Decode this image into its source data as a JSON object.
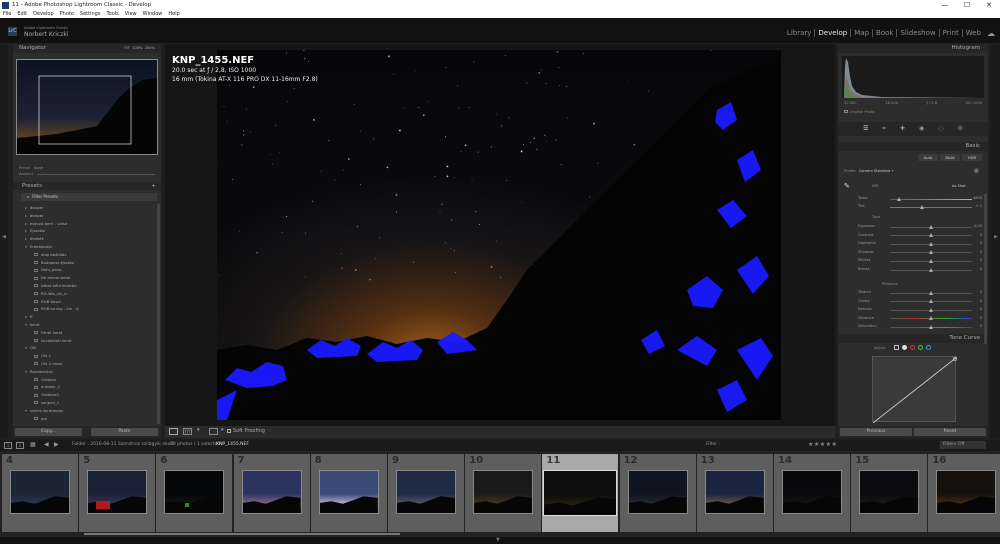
{
  "window": {
    "title": "11 - Adobe Photoshop Lightroom Classic - Develop",
    "min": "—",
    "max": "☐",
    "close": "✕"
  },
  "menu": [
    "File",
    "Edit",
    "Develop",
    "Photo",
    "Settings",
    "Tools",
    "View",
    "Window",
    "Help"
  ],
  "identity": {
    "badge": "LrC",
    "app": "Adobe Lightroom Classic",
    "user": "Norbert Kriczki"
  },
  "modules": [
    "Library",
    "Develop",
    "Map",
    "Book",
    "Slideshow",
    "Print",
    "Web"
  ],
  "active_module": "Develop",
  "left": {
    "navigator_label": "Navigator",
    "zoom": [
      "FIT",
      "100%",
      "200%"
    ],
    "preset_label": "Preset",
    "preset_value": "None",
    "amount_label": "Amount",
    "presets_label": "Presets",
    "filter_presets": "Filter Presets",
    "preset_items": [
      {
        "kind": "folder",
        "text": "áloszer"
      },
      {
        "kind": "folder",
        "text": "áloszer"
      },
      {
        "kind": "folder",
        "text": "eskuvő berri - valsa"
      },
      {
        "kind": "folder",
        "text": "Ejszakai"
      },
      {
        "kind": "folder",
        "text": "életkék"
      },
      {
        "kind": "folder",
        "text": "Erellátszats",
        "open": true
      },
      {
        "kind": "child",
        "text": "alap beállítás"
      },
      {
        "kind": "child",
        "text": "Budapest éjszaka"
      },
      {
        "kind": "child",
        "text": "Dahl_picsa"
      },
      {
        "kind": "child",
        "text": "De menanamal"
      },
      {
        "kind": "child",
        "text": "kékes kéúl keretbe"
      },
      {
        "kind": "child",
        "text": "RG-lálb_vin_lc"
      },
      {
        "kind": "child",
        "text": "RGB Basal"
      },
      {
        "kind": "child",
        "text": "RGB tuning - vin - lc"
      },
      {
        "kind": "folder",
        "text": "ff"
      },
      {
        "kind": "folder",
        "text": "keret",
        "open": true
      },
      {
        "kind": "child",
        "text": "Fehér keret"
      },
      {
        "kind": "child",
        "text": "kaveküreti keret"
      },
      {
        "kind": "folder",
        "text": "Oki",
        "open": true
      },
      {
        "kind": "child",
        "text": "Oki-1"
      },
      {
        "kind": "child",
        "text": "Oki-2-mask"
      },
      {
        "kind": "folder",
        "text": "Randezvány",
        "open": true
      },
      {
        "kind": "child",
        "text": "Outdoor"
      },
      {
        "kind": "child",
        "text": "outdoor_1"
      },
      {
        "kind": "child",
        "text": "Outdoor2"
      },
      {
        "kind": "child",
        "text": "sonped_1"
      },
      {
        "kind": "folder",
        "text": "színes kontraszos",
        "open": true
      },
      {
        "kind": "child",
        "text": "adi"
      }
    ],
    "copy_label": "Copy...",
    "paste_label": "Paste"
  },
  "photo": {
    "filename": "KNP_1455.NEF",
    "exposure_line": "20.0 sec at ƒ / 2,8, ISO 1000",
    "lens_line": "16 mm (Tokina AT-X 116 PRO DX 11-16mm F2.8)"
  },
  "toolbar": {
    "soft_proofing": "Soft Proofing"
  },
  "right": {
    "histogram_label": "Histogram",
    "hist_info": [
      "30 SEC",
      "16 mm",
      "ƒ / 2,8",
      "ISO 1000"
    ],
    "original_photo": "Original Photo",
    "basic_label": "Basic",
    "treat_buttons": [
      "Auto",
      "B&W",
      "HDR"
    ],
    "profile_label": "Profile:",
    "profile_value": "Camera Standard",
    "wb_label": "WB:",
    "wb_value": "As Shot",
    "temp_label": "Temp",
    "temp_value": "4800",
    "tint_label": "Tint",
    "tint_value": "+ 1",
    "tone_label": "Tone",
    "sliders_tone": [
      {
        "label": "Exposure",
        "value": "0,00",
        "pos": 0.5
      },
      {
        "label": "Contrast",
        "value": "0",
        "pos": 0.5
      },
      {
        "label": "Highlights",
        "value": "0",
        "pos": 0.5
      },
      {
        "label": "Shadows",
        "value": "0",
        "pos": 0.5
      },
      {
        "label": "Whites",
        "value": "0",
        "pos": 0.5
      },
      {
        "label": "Blacks",
        "value": "0",
        "pos": 0.5
      }
    ],
    "presence_label": "Presence",
    "sliders_presence": [
      {
        "label": "Texture",
        "value": "0",
        "pos": 0.5
      },
      {
        "label": "Clarity",
        "value": "0",
        "pos": 0.5
      },
      {
        "label": "Dehaze",
        "value": "0",
        "pos": 0.5
      },
      {
        "label": "Vibrance",
        "value": "0",
        "pos": 0.5
      },
      {
        "label": "Saturation",
        "value": "0",
        "pos": 0.5
      }
    ],
    "tonecurve_label": "Tone Curve",
    "adjust_label": "Adjust",
    "previous_label": "Previous",
    "reset_label": "Reset"
  },
  "filmbar": {
    "folder_text": "Folder : 2016-08-11 Szendrvai szilágyik ekelt",
    "count_text": "39 photos / 1 selected /",
    "selected_name": "KNP_1455.NEF",
    "filter_label": "Filter :",
    "filter_value": "Filters Off"
  },
  "filmstrip": [
    {
      "num": "4",
      "sky": "#1c2533",
      "glow": "#2b3a55"
    },
    {
      "num": "5",
      "sky": "#1a2238",
      "glow": "#3a3050",
      "red": true
    },
    {
      "num": "6",
      "sky": "#050608",
      "glow": "#101418",
      "green": true
    },
    {
      "num": "7",
      "sky": "#2b3560",
      "glow": "#8a6a8a"
    },
    {
      "num": "8",
      "sky": "#3b4a78",
      "glow": "#c9b8d8"
    },
    {
      "num": "9",
      "sky": "#1f2a44",
      "glow": "#5a5a6a"
    },
    {
      "num": "10",
      "sky": "#1a1a1a",
      "glow": "#4a3a20"
    },
    {
      "num": "11",
      "sky": "#0e0e0e",
      "glow": "#2a2010",
      "selected": true
    },
    {
      "num": "12",
      "sky": "#101522",
      "glow": "#2a2a30"
    },
    {
      "num": "13",
      "sky": "#1b2440",
      "glow": "#6a5a4a"
    },
    {
      "num": "14",
      "sky": "#0a0a0c",
      "glow": "#141414"
    },
    {
      "num": "15",
      "sky": "#0c0c10",
      "glow": "#181818"
    },
    {
      "num": "16",
      "sky": "#14100a",
      "glow": "#4a3010"
    }
  ]
}
